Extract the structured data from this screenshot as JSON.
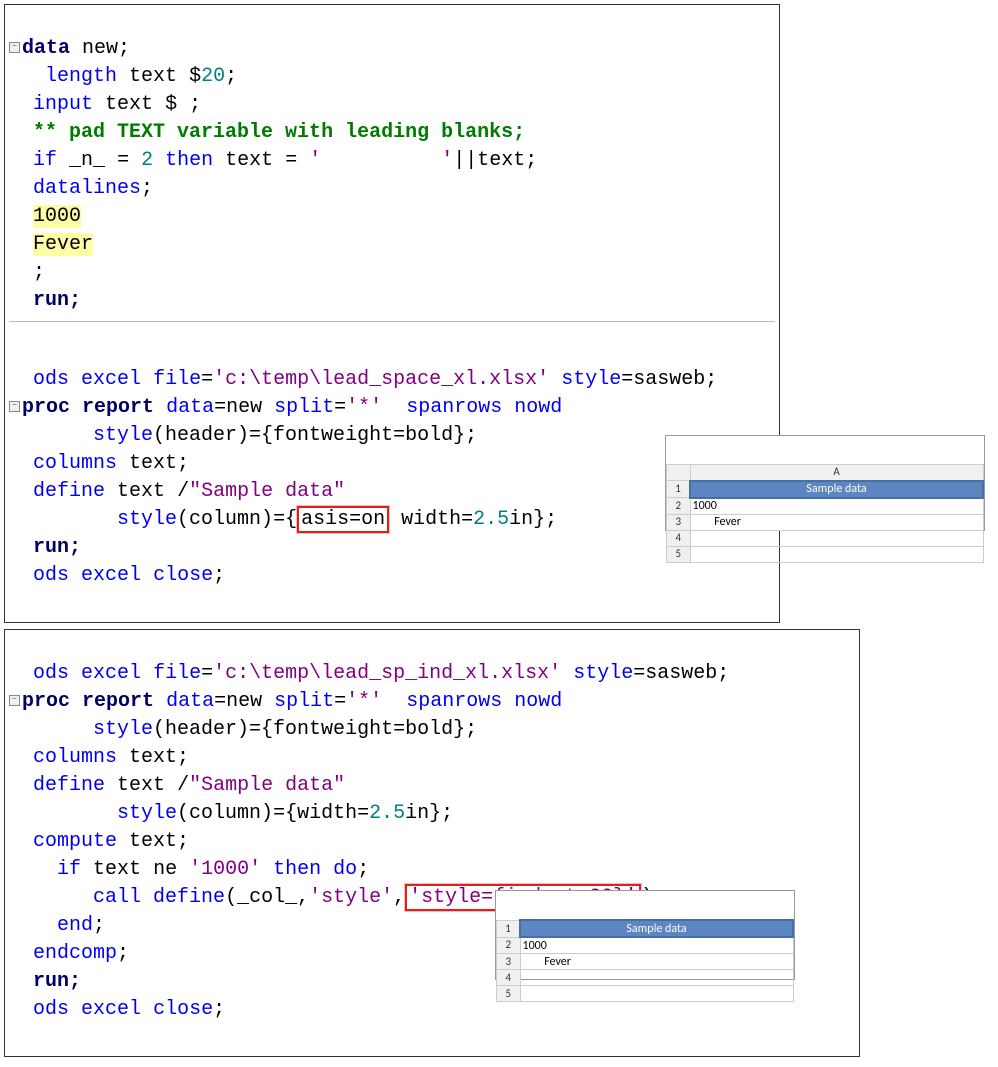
{
  "block1": {
    "l1_data": "data",
    "l1_new": "new",
    "l1_semi": ";",
    "l2_length": "length",
    "l2_text": "text",
    "l2_dollar": "$",
    "l2_20": "20",
    "l2_semi": ";",
    "l3_input": "input",
    "l3_text": "text",
    "l3_dollar": "$",
    "l3_semi": ";",
    "l4_cmt": "** pad TEXT variable with leading blanks;",
    "l5_if": "if",
    "l5_n": "_n_",
    "l5_eq": "=",
    "l5_2": "2",
    "l5_then": "then",
    "l5_text": "text",
    "l5_eq2": "=",
    "l5_str": "'          '",
    "l5_pipe": "||text;",
    "l6_datalines": "datalines",
    "l6_semi": ";",
    "l7_1000": "1000",
    "l8_fever": "Fever",
    "l9_semi": ";",
    "l10_run": "run",
    "l10_semi": ";",
    "l12_ods": "ods",
    "l12_excel": "excel",
    "l12_file": "file",
    "l12_eq": "=",
    "l12_str": "'c:\\temp\\lead_space_xl.xlsx'",
    "l12_style": "style",
    "l12_eq2": "=",
    "l12_sasweb": "sasweb;",
    "l13_proc": "proc",
    "l13_report": "report",
    "l13_data": "data",
    "l13_eq": "=",
    "l13_new": "new",
    "l13_split": "split",
    "l13_eq2": "=",
    "l13_str": "'*'",
    "l13_spanrows": "spanrows",
    "l13_nowd": "nowd",
    "l14_style": "style",
    "l14_header": "(header)={fontweight=bold};",
    "l15_columns": "columns",
    "l15_text": "text;",
    "l16_define": "define",
    "l16_text": "text",
    "l16_slash": "/",
    "l16_str": "\"Sample data\"",
    "l17_style": "style",
    "l17_col": "(column)={",
    "l17_asis": "asis=on",
    "l17_width": " width=",
    "l17_25": "2.5",
    "l17_in": "in};",
    "l18_run": "run",
    "l18_semi": ";",
    "l19_ods": "ods",
    "l19_excel": "excel",
    "l19_close": "close",
    "l19_semi": ";"
  },
  "block2": {
    "l1_ods": "ods",
    "l1_excel": "excel",
    "l1_file": "file",
    "l1_eq": "=",
    "l1_str": "'c:\\temp\\lead_sp_ind_xl.xlsx'",
    "l1_style": "style",
    "l1_eq2": "=",
    "l1_sasweb": "sasweb;",
    "l2_proc": "proc",
    "l2_report": "report",
    "l2_data": "data",
    "l2_eq": "=",
    "l2_new": "new",
    "l2_split": "split",
    "l2_eq2": "=",
    "l2_str": "'*'",
    "l2_spanrows": "spanrows",
    "l2_nowd": "nowd",
    "l3_style": "style",
    "l3_header": "(header)={fontweight=bold};",
    "l4_columns": "columns",
    "l4_text": "text;",
    "l5_define": "define",
    "l5_text": "text",
    "l5_slash": "/",
    "l5_str": "\"Sample data\"",
    "l6_style": "style",
    "l6_col": "(column)={width=",
    "l6_25": "2.5",
    "l6_in": "in};",
    "l7_compute": "compute",
    "l7_text": "text;",
    "l8_if": "if",
    "l8_text": "text",
    "l8_ne": "ne",
    "l8_str": "'1000'",
    "l8_then": "then",
    "l8_do": "do",
    "l8_semi": ";",
    "l9_call": "call",
    "l9_define": "define",
    "l9_open": "(_col_,",
    "l9_s1": "'style'",
    "l9_comma": ",",
    "l9_s2": "'style={indent=30}'",
    "l9_close": ");",
    "l10_end": "end",
    "l10_semi": ";",
    "l11_endcomp": "endcomp",
    "l11_semi": ";",
    "l12_run": "run",
    "l12_semi": ";",
    "l13_ods": "ods",
    "l13_excel": "excel",
    "l13_close": "close",
    "l13_semi": ";"
  },
  "excel1": {
    "colA": "A",
    "row1": "1",
    "row2": "2",
    "row3": "3",
    "row4": "4",
    "row5": "5",
    "header": "Sample data",
    "v2": "1000",
    "v3": "        Fever"
  },
  "excel2": {
    "row1": "1",
    "row2": "2",
    "row3": "3",
    "row4": "4",
    "row5": "5",
    "header": "Sample data",
    "v2": "1000",
    "v3": "        Fever"
  }
}
